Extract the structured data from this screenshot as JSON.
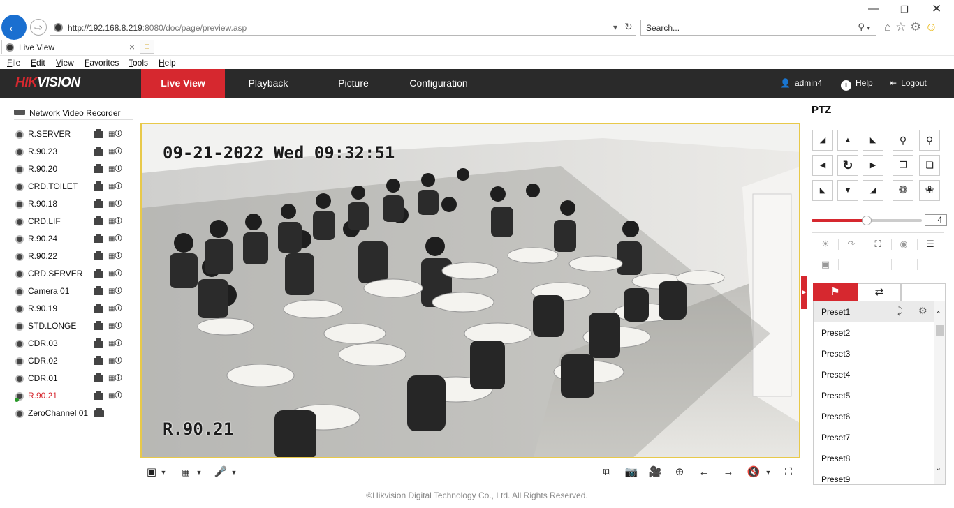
{
  "browser": {
    "url_host": "http://192.168.8.219",
    "url_rest": ":8080/doc/page/preview.asp",
    "search_placeholder": "Search...",
    "tab_title": "Live View",
    "menu": [
      "File",
      "Edit",
      "View",
      "Favorites",
      "Tools",
      "Help"
    ]
  },
  "header": {
    "logo_red": "HIK",
    "logo_white": "VISION",
    "nav": [
      "Live View",
      "Playback",
      "Picture",
      "Configuration"
    ],
    "active_nav": "Live View",
    "user": "admin4",
    "help": "Help",
    "logout": "Logout"
  },
  "device_tree": {
    "root": "Network Video Recorder",
    "cameras": [
      {
        "label": "R.SERVER"
      },
      {
        "label": "R.90.23"
      },
      {
        "label": "R.90.20"
      },
      {
        "label": "CRD.TOILET"
      },
      {
        "label": "R.90.18"
      },
      {
        "label": "CRD.LIF"
      },
      {
        "label": "R.90.24"
      },
      {
        "label": "R.90.22"
      },
      {
        "label": "CRD.SERVER"
      },
      {
        "label": "Camera 01"
      },
      {
        "label": "R.90.19"
      },
      {
        "label": "STD.LONGE"
      },
      {
        "label": "CDR.03"
      },
      {
        "label": "CDR.02"
      },
      {
        "label": "CDR.01"
      },
      {
        "label": "R.90.21"
      },
      {
        "label": "ZeroChannel 01"
      }
    ],
    "active_camera": "R.90.21"
  },
  "video": {
    "osd_time": "09-21-2022 Wed 09:32:51",
    "osd_name": "R.90.21"
  },
  "ptz": {
    "title": "PTZ",
    "speed": "4",
    "speed_fraction": 0.5,
    "presets": [
      "Preset1",
      "Preset2",
      "Preset3",
      "Preset4",
      "Preset5",
      "Preset6",
      "Preset7",
      "Preset8",
      "Preset9"
    ]
  },
  "footer": "©Hikvision Digital Technology Co., Ltd. All Rights Reserved.",
  "colors": {
    "brand_red": "#d6282f",
    "header_bg": "#2a2a2a",
    "video_border": "#e8c94a"
  }
}
